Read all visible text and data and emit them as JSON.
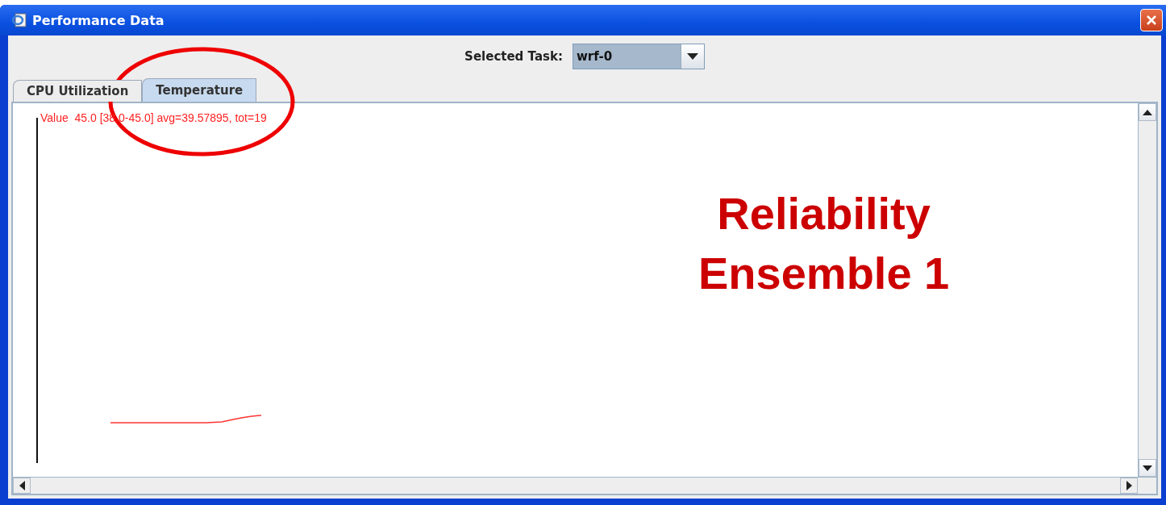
{
  "window": {
    "title": "Performance Data"
  },
  "task_selector": {
    "label": "Selected Task:",
    "value": "wrf-0"
  },
  "tabs": [
    {
      "label": "CPU Utilization",
      "selected": false
    },
    {
      "label": "Temperature",
      "selected": true
    }
  ],
  "plot": {
    "legend": "Value  45.0 [38.0-45.0] avg=39.57895, tot=19"
  },
  "annotation": {
    "lines": [
      "Reliability",
      "Ensemble 1"
    ]
  }
}
